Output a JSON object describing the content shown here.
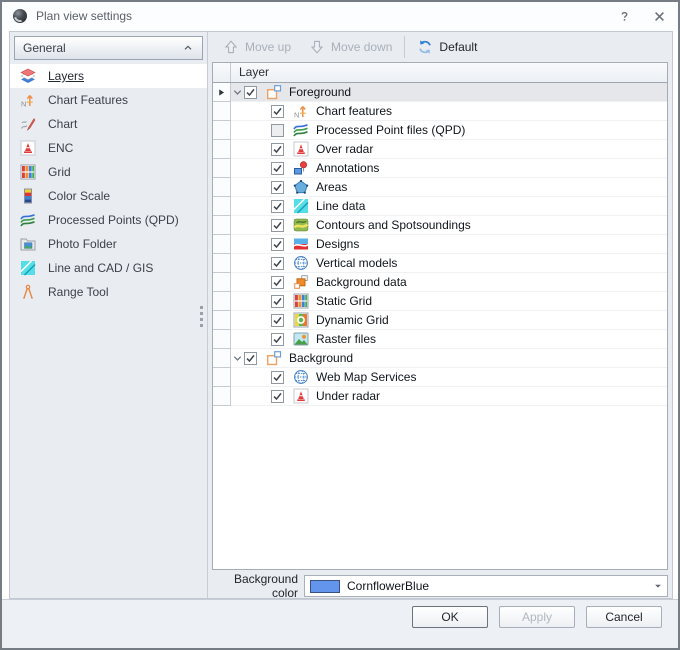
{
  "window": {
    "title": "Plan view settings",
    "help_icon": "help-icon",
    "close_icon": "close-icon"
  },
  "sidebar": {
    "header": {
      "label": "General",
      "collapse_icon": "chevron-up-icon"
    },
    "items": [
      {
        "label": "Layers",
        "icon": "layers",
        "selected": true
      },
      {
        "label": "Chart Features",
        "icon": "chart-features",
        "selected": false
      },
      {
        "label": "Chart",
        "icon": "chart",
        "selected": false
      },
      {
        "label": "ENC",
        "icon": "enc",
        "selected": false
      },
      {
        "label": "Grid",
        "icon": "grid",
        "selected": false
      },
      {
        "label": "Color Scale",
        "icon": "color-scale",
        "selected": false
      },
      {
        "label": "Processed Points (QPD)",
        "icon": "processed-points",
        "selected": false
      },
      {
        "label": "Photo Folder",
        "icon": "photo-folder",
        "selected": false
      },
      {
        "label": "Line and CAD / GIS",
        "icon": "line-cad-gis",
        "selected": false
      },
      {
        "label": "Range Tool",
        "icon": "range-tool",
        "selected": false
      }
    ]
  },
  "toolbar": {
    "buttons": [
      {
        "label": "Move up",
        "icon": "arrow-up",
        "enabled": false
      },
      {
        "label": "Move down",
        "icon": "arrow-down",
        "enabled": false
      },
      {
        "label": "Default",
        "icon": "refresh",
        "enabled": true
      }
    ]
  },
  "tree": {
    "column_header": "Layer",
    "rows": [
      {
        "label": "Foreground",
        "icon": "group",
        "checked": true,
        "group": true,
        "expanded": true,
        "selected": true,
        "row_indicator": true
      },
      {
        "label": "Chart features",
        "icon": "chart-features",
        "checked": true
      },
      {
        "label": "Processed Point files (QPD)",
        "icon": "processed-points",
        "checked": false
      },
      {
        "label": "Over radar",
        "icon": "radar-buoy",
        "checked": true
      },
      {
        "label": "Annotations",
        "icon": "annotations",
        "checked": true
      },
      {
        "label": "Areas",
        "icon": "areas",
        "checked": true
      },
      {
        "label": "Line data",
        "icon": "line-data",
        "checked": true
      },
      {
        "label": "Contours and Spotsoundings",
        "icon": "contours",
        "checked": true
      },
      {
        "label": "Designs",
        "icon": "designs",
        "checked": true
      },
      {
        "label": "Vertical models",
        "icon": "vertical-models",
        "checked": true
      },
      {
        "label": "Background data",
        "icon": "background-data",
        "checked": true
      },
      {
        "label": "Static Grid",
        "icon": "static-grid",
        "checked": true
      },
      {
        "label": "Dynamic Grid",
        "icon": "dynamic-grid",
        "checked": true
      },
      {
        "label": "Raster files",
        "icon": "raster-files",
        "checked": true
      },
      {
        "label": "Background",
        "icon": "group",
        "checked": true,
        "group": true,
        "expanded": true
      },
      {
        "label": "Web Map Services",
        "icon": "web-map-services",
        "checked": true
      },
      {
        "label": "Under radar",
        "icon": "radar-buoy",
        "checked": true
      }
    ]
  },
  "background_color": {
    "label": "Background color",
    "value": "CornflowerBlue",
    "swatch_hex": "#6495ED"
  },
  "footer": {
    "buttons": [
      {
        "label": "OK",
        "enabled": true,
        "default": true
      },
      {
        "label": "Apply",
        "enabled": false,
        "default": false
      },
      {
        "label": "Cancel",
        "enabled": true,
        "default": false
      }
    ]
  },
  "colors": {
    "accent_blue": "#2b7cd3",
    "selection_row": "#e6e7ea",
    "panel_background": "#e9ecf1",
    "swatch": "#6495ED"
  }
}
